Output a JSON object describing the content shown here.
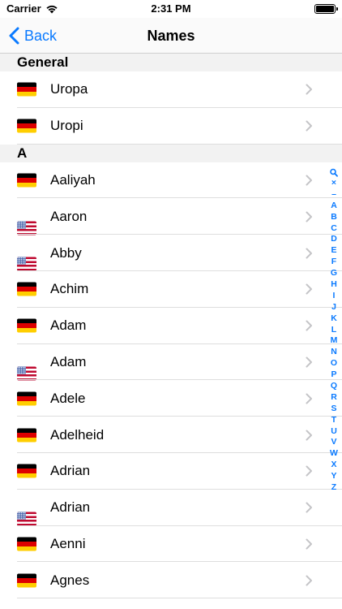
{
  "status_bar": {
    "carrier": "Carrier",
    "time": "2:31 PM",
    "icons": [
      "wifi-icon",
      "battery-icon"
    ]
  },
  "nav": {
    "back_label": "Back",
    "title": "Names",
    "accent_color": "#0a7aff"
  },
  "sections": [
    {
      "header": "General",
      "rows": [
        {
          "flag": "de",
          "label": "Uropa"
        },
        {
          "flag": "de",
          "label": "Uropi"
        }
      ]
    },
    {
      "header": "A",
      "rows": [
        {
          "flag": "de",
          "label": "Aaliyah"
        },
        {
          "flag": "us",
          "label": "Aaron"
        },
        {
          "flag": "us",
          "label": "Abby"
        },
        {
          "flag": "de",
          "label": "Achim"
        },
        {
          "flag": "de",
          "label": "Adam"
        },
        {
          "flag": "us",
          "label": "Adam"
        },
        {
          "flag": "de",
          "label": "Adele"
        },
        {
          "flag": "de",
          "label": "Adelheid"
        },
        {
          "flag": "de",
          "label": "Adrian"
        },
        {
          "flag": "us",
          "label": "Adrian"
        },
        {
          "flag": "de",
          "label": "Aenni"
        },
        {
          "flag": "de",
          "label": "Agnes"
        }
      ]
    }
  ],
  "index_letters": [
    "×",
    "–",
    "A",
    "B",
    "C",
    "D",
    "E",
    "F",
    "G",
    "H",
    "I",
    "J",
    "K",
    "L",
    "M",
    "N",
    "O",
    "P",
    "Q",
    "R",
    "S",
    "T",
    "U",
    "V",
    "W",
    "X",
    "Y",
    "Z"
  ]
}
